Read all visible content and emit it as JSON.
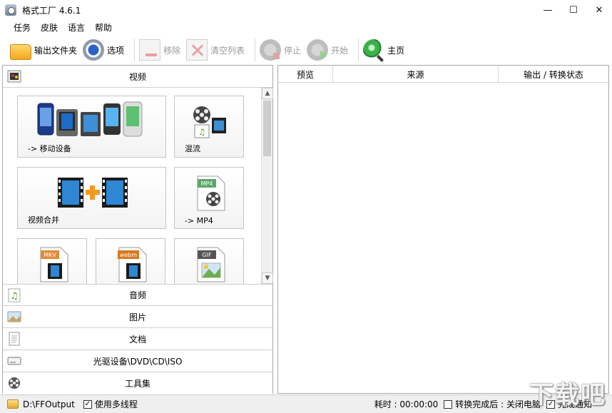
{
  "window": {
    "title": "格式工厂 4.6.1",
    "controls": {
      "minimize": "—",
      "maximize": "☐",
      "close": "✕"
    }
  },
  "menu": {
    "items": [
      {
        "label": "任务"
      },
      {
        "label": "皮肤"
      },
      {
        "label": "语言"
      },
      {
        "label": "帮助"
      }
    ]
  },
  "toolbar": {
    "output_folder": "输出文件夹",
    "options": "选项",
    "remove": "移除",
    "clear_list": "清空列表",
    "stop": "停止",
    "start": "开始",
    "home": "主页"
  },
  "left_panel": {
    "video_header": "视频",
    "tiles": {
      "mobile": "-> 移动设备",
      "mux": "混流",
      "merge": "视频合并",
      "mp4": "-> MP4",
      "mkv_badge": "MKV",
      "webm_badge": "webm",
      "gif_badge": "GIF",
      "mp4_badge": "MP4"
    },
    "categories": [
      {
        "label": "音频"
      },
      {
        "label": "图片"
      },
      {
        "label": "文档"
      },
      {
        "label": "光驱设备\\DVD\\CD\\ISO"
      },
      {
        "label": "工具集"
      }
    ]
  },
  "table": {
    "columns": [
      {
        "label": "预览"
      },
      {
        "label": "来源"
      },
      {
        "label": "输出 / 转换状态"
      }
    ]
  },
  "statusbar": {
    "output_path": "D:\\FFOutput",
    "multithread_label": "使用多线程",
    "multithread_checked": "✓",
    "elapsed": "耗时 : 00:00:00",
    "after_done_label": "转换完成后 : 关闭电脑",
    "notify_label": "完成通知",
    "notify_checked": "✓"
  },
  "watermark": "下载吧"
}
